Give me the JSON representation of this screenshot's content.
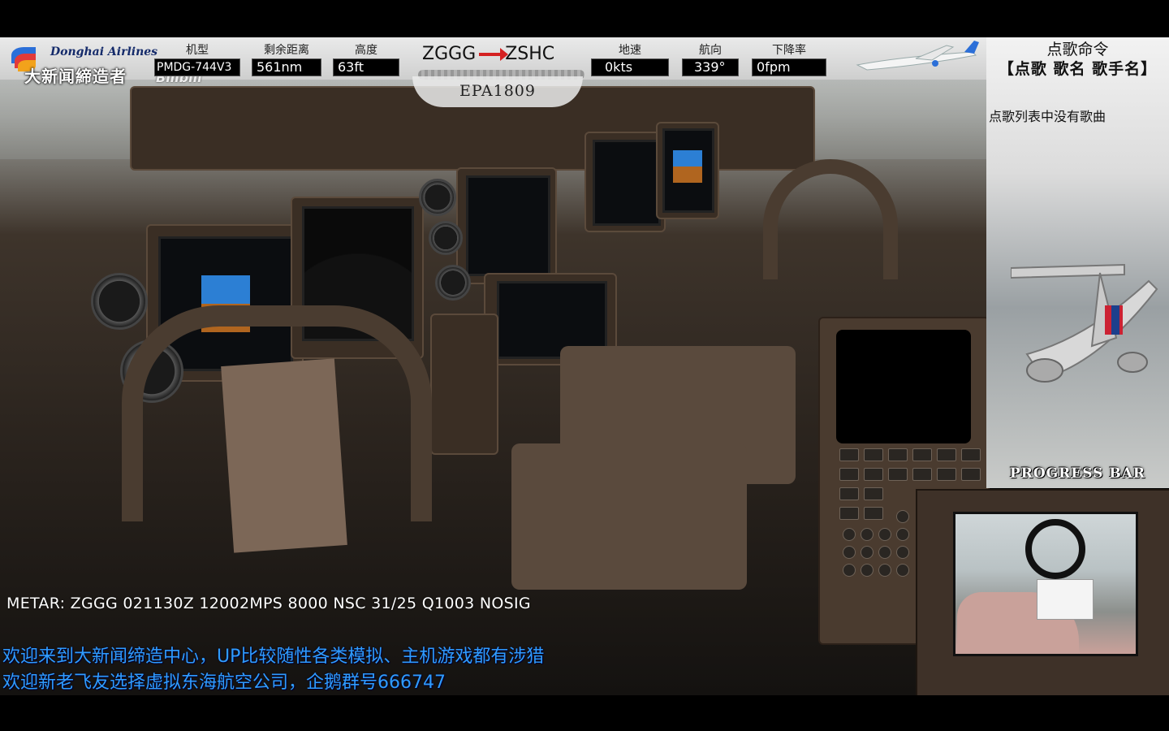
{
  "hud": {
    "brand": "Donghai Airlines",
    "channel_watermark": "大新闻締造者",
    "platform": "Bilibili",
    "fields": [
      {
        "label": "机型",
        "value": "PMDG-744V3"
      },
      {
        "label": "剩余距离",
        "value": "561nm"
      },
      {
        "label": "高度",
        "value": "63ft"
      },
      {
        "label": "地速",
        "value": "0kts"
      },
      {
        "label": "航向",
        "value": "339°"
      },
      {
        "label": "下降率",
        "value": "0fpm"
      }
    ],
    "origin": "ZGGG",
    "destination": "ZSHC",
    "flight_number": "EPA1809"
  },
  "song": {
    "title": "点歌命令",
    "command": "【点歌  歌名  歌手名】",
    "empty_message": "点歌列表中没有歌曲",
    "progress_label": "PROGRESS BAR"
  },
  "overlay": {
    "metar": "METAR: ZGGG 021130Z 12002MPS 8000 NSC 31/25 Q1003 NOSIG",
    "welcome_line1": "欢迎来到大新闻缔造中心，UP比较随性各类模拟、主机游戏都有涉猎",
    "welcome_line2": "欢迎新老飞友选择虚拟东海航空公司，企鹅群号666747"
  },
  "colors": {
    "welcome_text": "#2f9cff",
    "route_arrow": "#d42121",
    "hud_value_bg": "#000000"
  }
}
